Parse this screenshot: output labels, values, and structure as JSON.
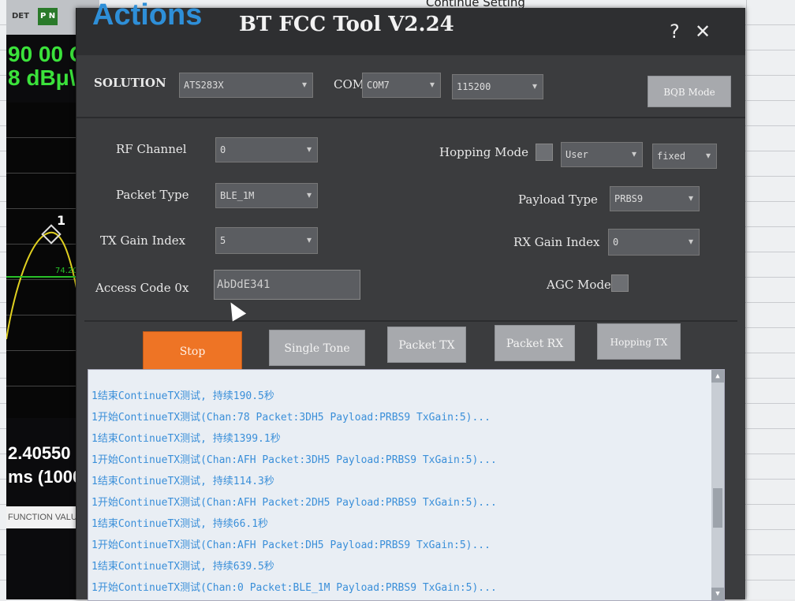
{
  "caption": "Continue Setting",
  "analyzer": {
    "tabs": [
      "DET",
      "P N"
    ],
    "freq_line1": "90 00 C",
    "freq_line2": "8 dBμ\\",
    "marker": "1",
    "marker_level": "74.20",
    "readout1": "2.40550",
    "readout2": "ms (1000",
    "function_label": "FUNCTION VALU"
  },
  "dialog": {
    "logo": "Actions",
    "title": "BT FCC Tool V2.24",
    "help_glyph": "?",
    "close_glyph": "✕",
    "solution_label": "SOLUTION",
    "solution_value": "ATS283X",
    "com_label": "COM",
    "com_value": "COM7",
    "baud_value": "115200",
    "bqb_mode_label": "BQB Mode",
    "rf_channel_label": "RF Channel",
    "rf_channel_value": "0",
    "packet_type_label": "Packet Type",
    "packet_type_value": "BLE_1M",
    "tx_gain_label": "TX Gain Index",
    "tx_gain_value": "5",
    "access_code_label": "Access Code 0x",
    "access_code_value": "AbDdE341",
    "hopping_mode_label": "Hopping Mode",
    "hopping_user_value": "User",
    "hopping_fixed_value": "fixed",
    "payload_type_label": "Payload Type",
    "payload_type_value": "PRBS9",
    "rx_gain_label": "RX Gain Index",
    "rx_gain_value": "0",
    "agc_mode_label": "AGC Mode",
    "buttons": {
      "stop": "Stop",
      "single_tone": "Single Tone",
      "packet_tx": "Packet TX",
      "packet_rx": "Packet RX",
      "hopping_tx": "Hopping TX"
    },
    "log_lines": [
      "1结束ContinueTX测试, 持续190.5秒",
      "1开始ContinueTX测试(Chan:78 Packet:3DH5 Payload:PRBS9 TxGain:5)...",
      "1结束ContinueTX测试, 持续1399.1秒",
      "1开始ContinueTX测试(Chan:AFH Packet:3DH5 Payload:PRBS9 TxGain:5)...",
      "1结束ContinueTX测试, 持续114.3秒",
      "1开始ContinueTX测试(Chan:AFH Packet:2DH5 Payload:PRBS9 TxGain:5)...",
      "1结束ContinueTX测试, 持续66.1秒",
      "1开始ContinueTX测试(Chan:AFH Packet:DH5 Payload:PRBS9 TxGain:5)...",
      "1结束ContinueTX测试, 持续639.5秒",
      "1开始ContinueTX测试(Chan:0 Packet:BLE_1M Payload:PRBS9 TxGain:5)..."
    ]
  }
}
